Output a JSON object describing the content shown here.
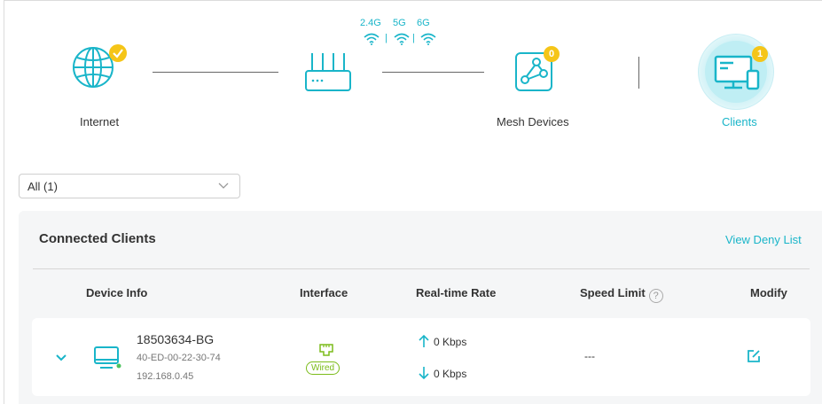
{
  "topology": {
    "internet_label": "Internet",
    "mesh_label": "Mesh Devices",
    "mesh_badge": "0",
    "clients_label": "Clients",
    "clients_badge": "1",
    "bands": [
      "2.4G",
      "5G",
      "6G"
    ],
    "accent": "#19b5c9",
    "badge_color": "#f5c518"
  },
  "filter": {
    "selected": "All (1)"
  },
  "panel": {
    "title": "Connected Clients",
    "deny_link": "View Deny List",
    "columns": {
      "device_info": "Device Info",
      "interface": "Interface",
      "rate": "Real-time Rate",
      "speed_limit": "Speed Limit",
      "modify": "Modify"
    },
    "rows": [
      {
        "name": "18503634-BG",
        "mac": "40-ED-00-22-30-74",
        "ip": "192.168.0.45",
        "interface": "Wired",
        "upload": "0 Kbps",
        "download": "0 Kbps",
        "speed_limit": "---"
      }
    ]
  }
}
